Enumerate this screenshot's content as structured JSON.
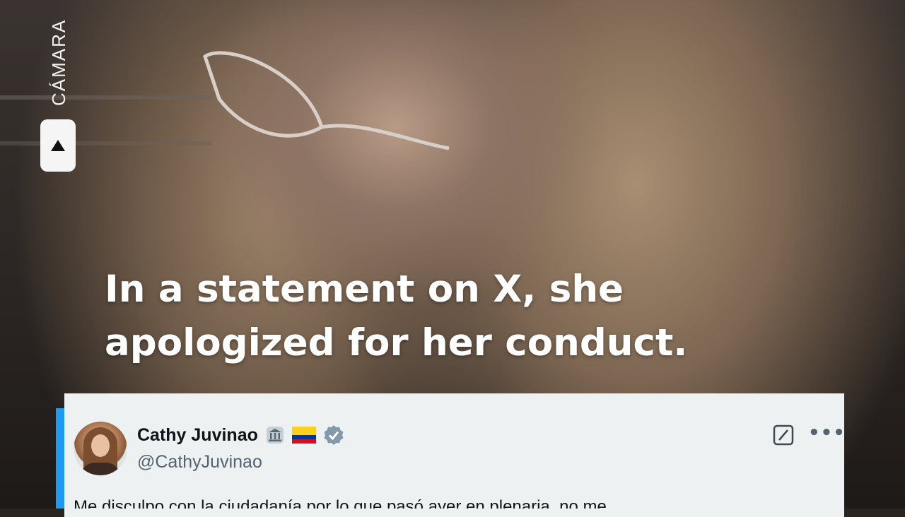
{
  "overlay": {
    "channel_label": "CÁMARA",
    "logo_icon": "triangle-up-icon"
  },
  "caption": {
    "line1": "In a statement on X, she",
    "line2": "apologized for her conduct."
  },
  "tweet": {
    "display_name": "Cathy Juvinao",
    "handle": "@CathyJuvinao",
    "badges": [
      "government-building-icon",
      "colombia-flag-icon",
      "verified-badge-icon"
    ],
    "text": "Me disculpo con la ciudadanía por lo que pasó ayer en plenaria, no me",
    "accent_color": "#1d9bf0",
    "actions": [
      "grok-icon",
      "more-options-icon"
    ]
  }
}
